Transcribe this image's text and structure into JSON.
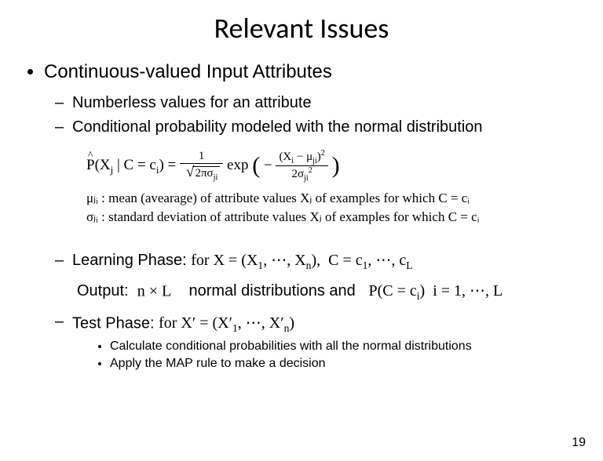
{
  "title": "Relevant Issues",
  "bullet1": "Continuous-valued Input Attributes",
  "sub1": "Numberless values for an attribute",
  "sub2": "Conditional probability modeled with the normal distribution",
  "eq_lhs": "P̂(Xⱼ | C = cᵢ) =",
  "eq_exp_label": "exp",
  "mu_def": "μⱼᵢ : mean (avearage) of attribute values Xⱼ of examples  for which C = cᵢ",
  "sigma_def": "σⱼᵢ : standard deviation of attribute values Xⱼ of examples  for which C = cᵢ",
  "sub3_label": "Learning Phase:",
  "sub3_for": "for X = (X₁, ⋯, Xₙ),  C = c₁, ⋯, c_L",
  "sub3_output_label": "Output:",
  "sub3_output_mid": "normal distributions and",
  "sub3_nL": "n × L",
  "sub3_Pc": "P(C = cᵢ)  i = 1, ⋯, L",
  "sub4_label": "Test Phase:",
  "sub4_for": "for X′ = (X′₁, ⋯, X′ₙ)",
  "tp1": "Calculate conditional probabilities with all the normal distributions",
  "tp2": "Apply the MAP rule to make a decision",
  "pagenum": "19",
  "chart_data": {
    "type": "table",
    "title": "Gaussian conditional probability for continuous attributes",
    "equation": "P_hat(X_j | C = c_i) = (1 / sqrt(2*pi*sigma_ji)) * exp( - (X_i - mu_ji)^2 / (2*sigma_ji^2) )",
    "parameters": {
      "mu_ji": "mean (average) of attribute values X_j of examples for which C = c_i",
      "sigma_ji": "standard deviation of attribute values X_j of examples for which C = c_i"
    },
    "learning_output_count": "n × L normal distributions",
    "priors": "P(C = c_i), i = 1,...,L"
  }
}
